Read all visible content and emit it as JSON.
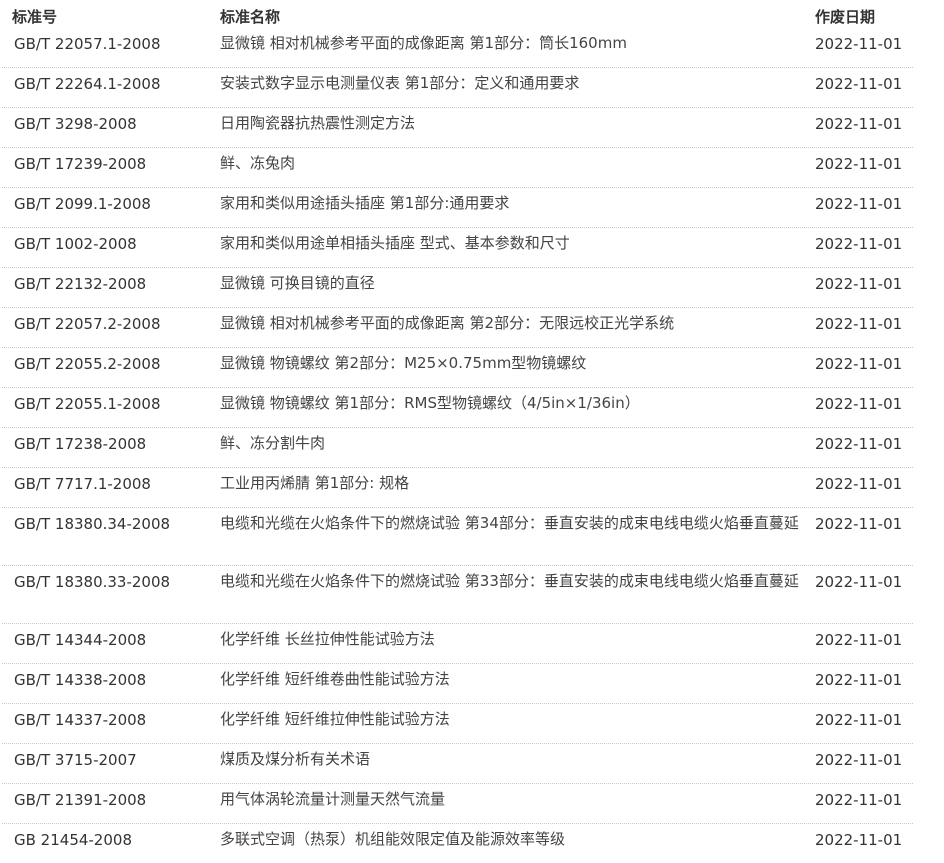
{
  "header": {
    "code": "标准号",
    "name": "标准名称",
    "date": "作废日期"
  },
  "rows": [
    {
      "code": "GB/T 22057.1-2008",
      "name": "显微镜 相对机械参考平面的成像距离 第1部分：筒长160mm",
      "date": "2022-11-01"
    },
    {
      "code": "GB/T 22264.1-2008",
      "name": "安装式数字显示电测量仪表 第1部分：定义和通用要求",
      "date": "2022-11-01"
    },
    {
      "code": "GB/T 3298-2008",
      "name": "日用陶瓷器抗热震性测定方法",
      "date": "2022-11-01"
    },
    {
      "code": "GB/T 17239-2008",
      "name": "鲜、冻兔肉",
      "date": "2022-11-01"
    },
    {
      "code": "GB/T 2099.1-2008",
      "name": "家用和类似用途插头插座 第1部分:通用要求",
      "date": "2022-11-01"
    },
    {
      "code": "GB/T 1002-2008",
      "name": "家用和类似用途单相插头插座 型式、基本参数和尺寸",
      "date": "2022-11-01"
    },
    {
      "code": "GB/T 22132-2008",
      "name": "显微镜 可换目镜的直径",
      "date": "2022-11-01"
    },
    {
      "code": "GB/T 22057.2-2008",
      "name": "显微镜 相对机械参考平面的成像距离 第2部分：无限远校正光学系统",
      "date": "2022-11-01"
    },
    {
      "code": "GB/T 22055.2-2008",
      "name": "显微镜 物镜螺纹 第2部分：M25×0.75mm型物镜螺纹",
      "date": "2022-11-01"
    },
    {
      "code": "GB/T 22055.1-2008",
      "name": "显微镜 物镜螺纹 第1部分：RMS型物镜螺纹（4/5in×1/36in）",
      "date": "2022-11-01"
    },
    {
      "code": "GB/T 17238-2008",
      "name": "鲜、冻分割牛肉",
      "date": "2022-11-01"
    },
    {
      "code": "GB/T 7717.1-2008",
      "name": "工业用丙烯腈 第1部分: 规格",
      "date": "2022-11-01"
    },
    {
      "code": "GB/T 18380.34-2008",
      "name": "电缆和光缆在火焰条件下的燃烧试验 第34部分：垂直安装的成束电线电缆火焰垂直蔓延",
      "date": "2022-11-01"
    },
    {
      "code": "GB/T 18380.33-2008",
      "name": "电缆和光缆在火焰条件下的燃烧试验 第33部分：垂直安装的成束电线电缆火焰垂直蔓延",
      "date": "2022-11-01"
    },
    {
      "code": "GB/T 14344-2008",
      "name": "化学纤维 长丝拉伸性能试验方法",
      "date": "2022-11-01"
    },
    {
      "code": "GB/T 14338-2008",
      "name": "化学纤维 短纤维卷曲性能试验方法",
      "date": "2022-11-01"
    },
    {
      "code": "GB/T 14337-2008",
      "name": "化学纤维 短纤维拉伸性能试验方法",
      "date": "2022-11-01"
    },
    {
      "code": "GB/T 3715-2007",
      "name": "煤质及煤分析有关术语",
      "date": "2022-11-01"
    },
    {
      "code": "GB/T 21391-2008",
      "name": "用气体涡轮流量计测量天然气流量",
      "date": "2022-11-01"
    },
    {
      "code": "GB 21454-2008",
      "name": "多联式空调（热泵）机组能效限定值及能源效率等级",
      "date": "2022-11-01"
    }
  ]
}
